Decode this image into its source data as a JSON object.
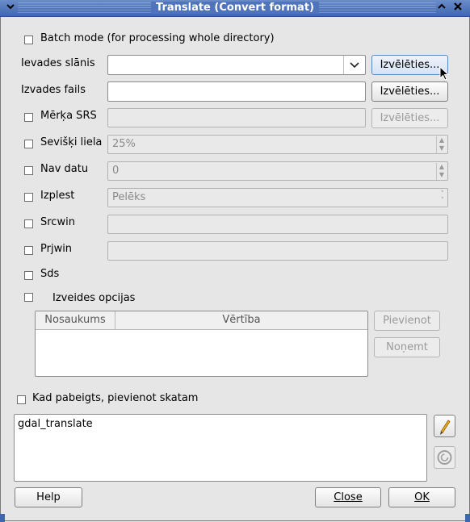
{
  "window": {
    "title": "Translate (Convert format)",
    "menu_icon": "chevron-down-icon",
    "maximize_icon": "chevron-up-icon",
    "close_icon": "close-icon"
  },
  "batch_mode": {
    "label": "Batch mode (for processing whole directory)",
    "checked": false
  },
  "input_layer": {
    "label": "Ievades slānis",
    "value": "",
    "button": "Izvēlēties..."
  },
  "output_file": {
    "label": "Izvades fails",
    "value": "",
    "button": "Izvēlēties..."
  },
  "target_srs": {
    "label": "Mērķa SRS",
    "value": "",
    "button": "Izvēlēties...",
    "checked": false
  },
  "outsize": {
    "label": "Sevišķi liela",
    "value": "25%",
    "checked": false
  },
  "nodata": {
    "label": "Nav datu",
    "value": "0",
    "checked": false
  },
  "expand": {
    "label": "Izplest",
    "value": "Pelēks",
    "checked": false
  },
  "srcwin": {
    "label": "Srcwin",
    "value": "",
    "checked": false
  },
  "prjwin": {
    "label": "Prjwin",
    "value": "",
    "checked": false
  },
  "sds": {
    "label": "Sds",
    "checked": false
  },
  "creation_options": {
    "label": "Izveides opcijas",
    "checked": false,
    "columns": [
      "Nosaukums",
      "Vērtība"
    ],
    "add_button": "Pievienot",
    "remove_button": "Noņemt"
  },
  "load_when_done": {
    "label": "Kad pabeigts, pievienot skatam",
    "checked": false
  },
  "command": {
    "text": "gdal_translate",
    "edit_icon": "pencil-icon",
    "reset_icon": "reset-icon"
  },
  "footer": {
    "help": "Help",
    "close": "Close",
    "ok": "OK"
  }
}
